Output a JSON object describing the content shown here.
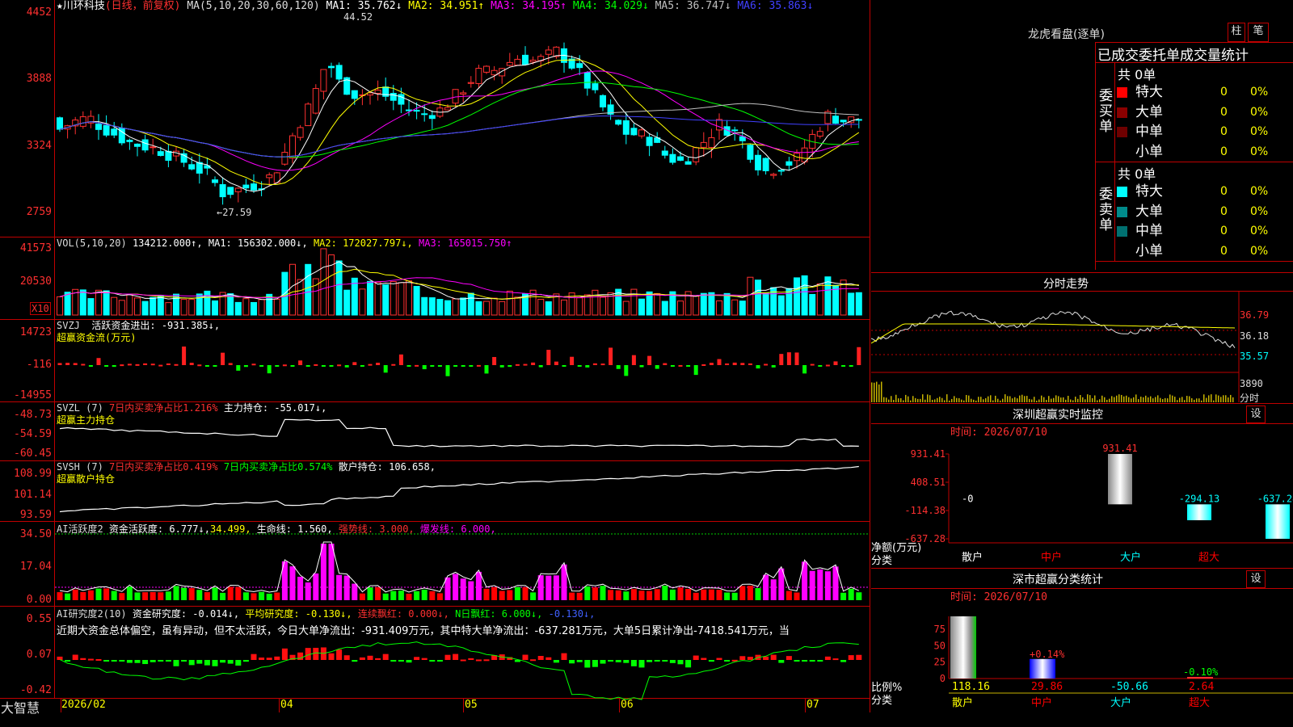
{
  "app": {
    "brand": "大智慧",
    "star": "★"
  },
  "stock": {
    "name": "川环科技",
    "mode": "(日线，前复权)"
  },
  "main": {
    "ma_prefix": "MA(5,10,20,30,60,120)",
    "ma": [
      {
        "label": "MA1:",
        "value": "35.762↓",
        "color": "#ffffff"
      },
      {
        "label": "MA2:",
        "value": "34.951↑",
        "color": "#ffff00"
      },
      {
        "label": "MA3:",
        "value": "34.195↑",
        "color": "#ff00ff"
      },
      {
        "label": "MA4:",
        "value": "34.029↓",
        "color": "#00ff00"
      },
      {
        "label": "MA5:",
        "value": "36.747↓",
        "color": "#c0c0c0"
      },
      {
        "label": "MA6:",
        "value": "35.863↓",
        "color": "#4040ff"
      }
    ],
    "y_ticks": [
      "4452",
      "3888",
      "3324",
      "2759"
    ],
    "high_label": "44.52",
    "low_label": "←27.59"
  },
  "vol": {
    "prefix": "VOL(5,10,20)",
    "value": "134212.000↑,",
    "ma": [
      {
        "label": "MA1:",
        "value": "156302.000↓,",
        "color": "#ffffff"
      },
      {
        "label": "MA2:",
        "value": "172027.797↓,",
        "color": "#ffff00"
      },
      {
        "label": "MA3:",
        "value": "165015.750↑",
        "color": "#ff00ff"
      }
    ],
    "y_ticks": [
      "41573",
      "20530"
    ],
    "unit": "X10"
  },
  "svzj": {
    "prefix": "SVZJ",
    "label": "活跃资金进出:",
    "value": "-931.385↓,",
    "sub": "超赢资金流(万元)",
    "y_ticks": [
      "14723",
      "-116",
      "-14955"
    ]
  },
  "svzl": {
    "prefix": "SVZL (7)",
    "red_label": "7日内买卖净占比1.216%",
    "label": "主力持仓:",
    "value": "-55.017↓,",
    "sub": "超赢主力持仓",
    "y_ticks": [
      "-48.73",
      "-54.59",
      "-60.45"
    ]
  },
  "svsh": {
    "prefix": "SVSH (7)",
    "red_label": "7日内买卖净占比0.419%",
    "green_label": "7日内买卖净占比0.574%",
    "label": "散户持仓:",
    "value": "106.658,",
    "sub": "超赢散户持仓",
    "y_ticks": [
      "108.99",
      "101.14",
      "93.59"
    ]
  },
  "ai1": {
    "prefix": "AI活跃度2",
    "label": "资金活跃度:",
    "value": "6.777↓,",
    "value2": "34.499,",
    "label3": "生命线:",
    "value3": "1.560,",
    "label4": "强势线:",
    "value4": "3.000,",
    "label5": "爆发线:",
    "value5": "6.000,",
    "y_ticks": [
      "34.50",
      "17.04",
      "0.00"
    ]
  },
  "ai2": {
    "prefix": "AI研究度2(10)",
    "label": "资金研究度:",
    "value": "-0.014↓,",
    "label2": "平均研究度:",
    "value2": "-0.130↓,",
    "label3": "连续飘红:",
    "value3": "0.000↓,",
    "label4": "N日飘红:",
    "value4": "6.000↓,",
    "value5": "-0.130↓,",
    "text": "近期大资金总体偏空，虽有异动，但不太活跃，今日大单净流出：-931.409万元，其中特大单净流出：-637.281万元，大单5日累计净出-7418.541万元，当",
    "y_ticks": [
      "0.55",
      "0.07",
      "-0.42"
    ]
  },
  "dates": [
    "2026/02",
    "04",
    "05",
    "06",
    "07"
  ],
  "dragon": {
    "title": "龙虎看盘(逐单)",
    "btn1": "柱",
    "btn2": "笔",
    "tabs": "已成交委托单成交量统计",
    "buy_side": "委买单",
    "sell_side": "委卖单",
    "buy_total": "共 0单",
    "sell_total": "共 0单",
    "buy_rows": [
      {
        "name": "特大",
        "count": "0",
        "pct": "0%",
        "color": "#ff0000"
      },
      {
        "name": "大单",
        "count": "0",
        "pct": "0%",
        "color": "#8b0000"
      },
      {
        "name": "中单",
        "count": "0",
        "pct": "0%",
        "color": "#6e0000"
      },
      {
        "name": "小单",
        "count": "0",
        "pct": "0%",
        "color": ""
      }
    ],
    "sell_rows": [
      {
        "name": "特大",
        "count": "0",
        "pct": "0%",
        "color": "#00ffff"
      },
      {
        "name": "大单",
        "count": "0",
        "pct": "0%",
        "color": "#008b8b"
      },
      {
        "name": "中单",
        "count": "0",
        "pct": "0%",
        "color": "#007070"
      },
      {
        "name": "小单",
        "count": "0",
        "pct": "0%",
        "color": ""
      }
    ]
  },
  "intraday": {
    "title": "分时走势",
    "prices": [
      "36.79",
      "36.18",
      "35.57"
    ],
    "volume": "3890",
    "unit": "分时"
  },
  "monitor": {
    "title": "深圳超赢实时监控",
    "btn": "设",
    "time": "时间: 2026/07/10",
    "y_ticks": [
      "931.41",
      "408.51",
      "-114.38",
      "-637.28"
    ],
    "ylabel": "净额(万元)",
    "xlabel": "分类",
    "zero_label": "-0",
    "categories": [
      "散户",
      "中户",
      "大户",
      "超大"
    ],
    "cat_colors": [
      "#ffffff",
      "#ff0000",
      "#00ffff",
      "#ff0000"
    ]
  },
  "classify": {
    "title": "深市超赢分类统计",
    "btn": "设",
    "time": "时间: 2026/07/10",
    "y_ticks": [
      "75",
      "50",
      "25",
      "0"
    ],
    "ylabel": "比例%",
    "xlabel": "分类",
    "categories": [
      "散户",
      "中户",
      "大户",
      "超大"
    ],
    "cat_colors": [
      "#ffff00",
      "#ff0000",
      "#00ffff",
      "#ff0000"
    ],
    "pct_labels": [
      "",
      "+0.14%",
      "",
      "-0.10%"
    ],
    "bottom_values": [
      "118.16",
      "29.86",
      "-50.66",
      "2.64"
    ]
  },
  "chart_data": [
    {
      "type": "bar",
      "title": "深圳超赢实时监控",
      "categories": [
        "散户",
        "中户",
        "大户",
        "超大"
      ],
      "values": [
        0,
        931.41,
        -294.13,
        -637.28
      ],
      "ylabel": "净额(万元)",
      "xlabel": "分类",
      "ylim": [
        -637.28,
        931.41
      ]
    },
    {
      "type": "bar",
      "title": "深市超赢分类统计",
      "categories": [
        "散户",
        "中户",
        "大户",
        "超大"
      ],
      "values": [
        118.16,
        29.86,
        -50.66,
        2.64
      ],
      "ylabel": "比例%",
      "xlabel": "分类",
      "ylim": [
        0,
        75
      ]
    }
  ]
}
